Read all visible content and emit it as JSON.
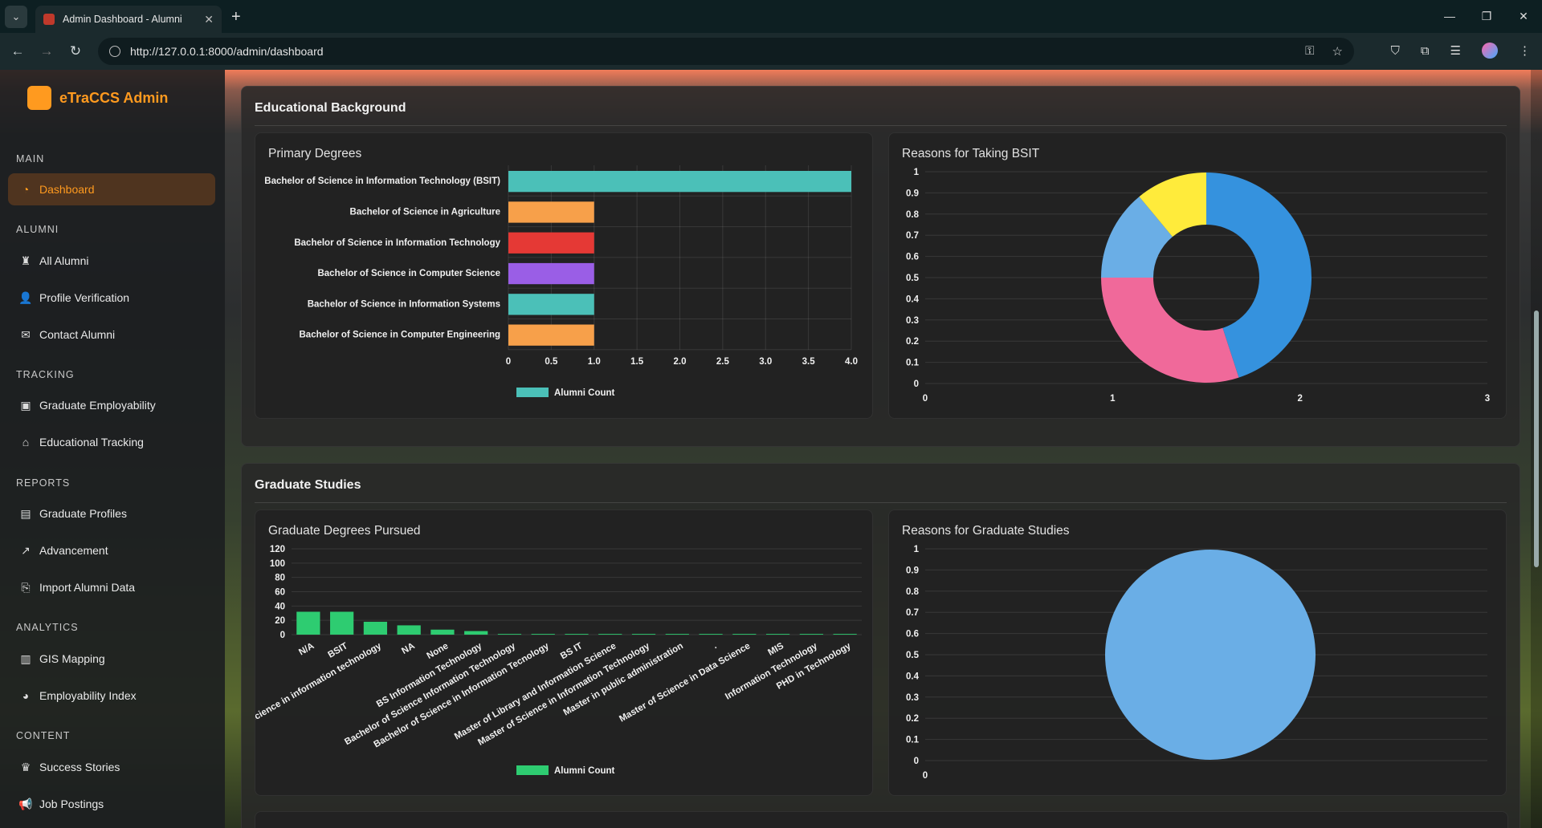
{
  "browser": {
    "tab_title": "Admin Dashboard - Alumni",
    "url": "http://127.0.0.1:8000/admin/dashboard"
  },
  "sidebar": {
    "brand": "eTraCCS Admin",
    "sections": [
      {
        "label": "MAIN"
      },
      {
        "label": "ALUMNI"
      },
      {
        "label": "TRACKING"
      },
      {
        "label": "REPORTS"
      },
      {
        "label": "ANALYTICS"
      },
      {
        "label": "CONTENT"
      }
    ],
    "items": [
      {
        "label": "Dashboard",
        "icon": "dashboard-icon"
      },
      {
        "label": "All Alumni",
        "icon": "users-icon"
      },
      {
        "label": "Profile Verification",
        "icon": "user-check-icon"
      },
      {
        "label": "Contact Alumni",
        "icon": "envelope-icon"
      },
      {
        "label": "Graduate Employability",
        "icon": "briefcase-icon"
      },
      {
        "label": "Educational Tracking",
        "icon": "university-icon"
      },
      {
        "label": "Graduate Profiles",
        "icon": "id-card-icon"
      },
      {
        "label": "Advancement",
        "icon": "line-chart-icon"
      },
      {
        "label": "Import Alumni Data",
        "icon": "import-file-icon"
      },
      {
        "label": "GIS Mapping",
        "icon": "map-icon"
      },
      {
        "label": "Employability Index",
        "icon": "pie-chart-icon"
      },
      {
        "label": "Success Stories",
        "icon": "trophy-icon"
      },
      {
        "label": "Job Postings",
        "icon": "megaphone-icon"
      }
    ]
  },
  "sections": {
    "educational": {
      "title": "Educational Background"
    },
    "graduate": {
      "title": "Graduate Studies"
    }
  },
  "colors": {
    "accent": "#ff9a1f",
    "teal": "#4bc0b8",
    "orange": "#f7a04a",
    "red": "#e53935",
    "purple": "#9a5ee6",
    "green": "#2ecc71",
    "blue": "#3592de",
    "pink": "#f0699a",
    "lightblue": "#6aaee6",
    "yellow": "#ffeb3b"
  },
  "chart_data": [
    {
      "id": "primary-degrees",
      "title": "Primary Degrees",
      "type": "bar",
      "orientation": "horizontal",
      "categories": [
        "Bachelor of Science in Information Technology (BSIT)",
        "Bachelor of Science in Agriculture",
        "Bachelor of Science in Information Technology",
        "Bachelor of Science in Computer Science",
        "Bachelor of Science in Information Systems",
        "Bachelor of Science in Computer Engineering"
      ],
      "series": [
        {
          "name": "Alumni Count",
          "values": [
            4,
            1,
            1,
            1,
            1,
            1
          ]
        }
      ],
      "bar_colors": [
        "#4bc0b8",
        "#f7a04a",
        "#e53935",
        "#9a5ee6",
        "#4bc0b8",
        "#f7a04a"
      ],
      "xlim": [
        0,
        4
      ],
      "xticks": [
        "0",
        "0.5",
        "1.0",
        "1.5",
        "2.0",
        "2.5",
        "3.0",
        "3.5",
        "4.0"
      ],
      "legend": "bottom"
    },
    {
      "id": "reasons-bsit",
      "title": "Reasons for Taking BSIT",
      "type": "pie",
      "donut": true,
      "values": [
        45,
        30,
        14,
        11
      ],
      "slice_colors": [
        "#3592de",
        "#f0699a",
        "#6aaee6",
        "#ffeb3b"
      ],
      "yticks": [
        "1",
        "0.9",
        "0.8",
        "0.7",
        "0.6",
        "0.5",
        "0.4",
        "0.3",
        "0.2",
        "0.1",
        "0"
      ],
      "xticks": [
        "0",
        "1",
        "2",
        "3"
      ]
    },
    {
      "id": "graduate-degrees",
      "title": "Graduate Degrees Pursued",
      "type": "bar",
      "categories": [
        "N/A",
        "BSIT",
        "of Science in information technology",
        "NA",
        "None",
        "BS Information Technology",
        "Bachelor of Science Information Technology",
        "Bachelor of Science in Information Tecnology",
        "BS IT",
        "Master of Library and Information Science",
        "Master of Science in Information Technology",
        "Master in public administration",
        ".",
        "Master of Science in  Data Science",
        "MIS",
        "Information Technology",
        "PHD in Technology"
      ],
      "series": [
        {
          "name": "Alumni Count",
          "values": [
            32,
            32,
            18,
            13,
            7,
            5,
            1,
            1,
            1,
            1,
            1,
            1,
            1,
            1,
            1,
            1,
            1
          ]
        }
      ],
      "ylim": [
        0,
        120
      ],
      "yticks": [
        "120",
        "100",
        "80",
        "60",
        "40",
        "20",
        "0"
      ],
      "legend": "bottom"
    },
    {
      "id": "reasons-graduate",
      "title": "Reasons for Graduate Studies",
      "type": "pie",
      "values": [
        1
      ],
      "slice_colors": [
        "#6aaee6"
      ],
      "yticks": [
        "1",
        "0.9",
        "0.8",
        "0.7",
        "0.6",
        "0.5",
        "0.4",
        "0.3",
        "0.2",
        "0.1",
        "0"
      ],
      "xticks": [
        "0"
      ]
    }
  ]
}
